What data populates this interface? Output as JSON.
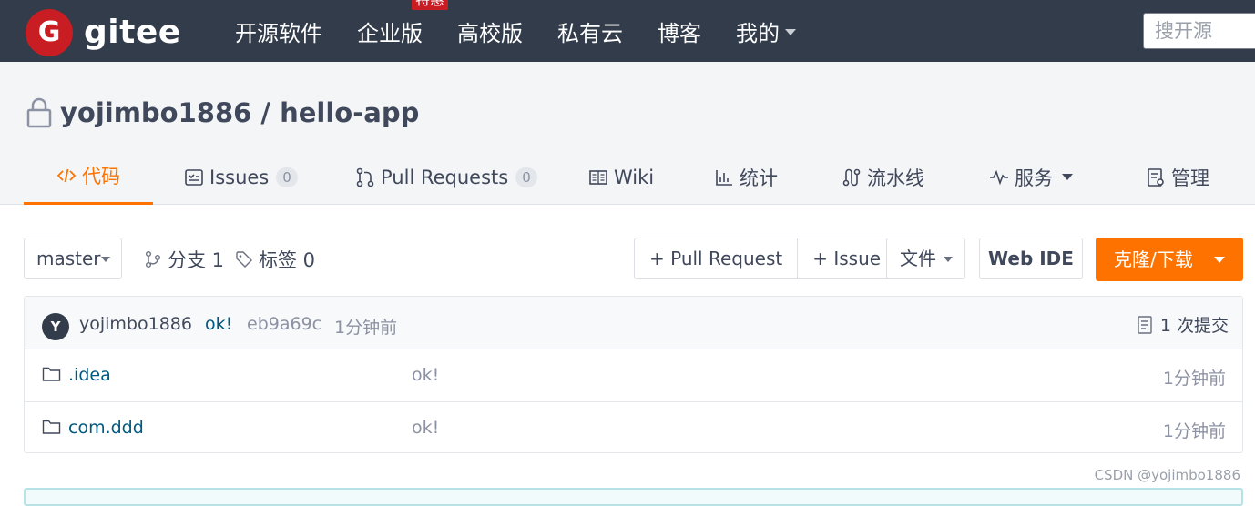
{
  "topbar": {
    "logo_glyph": "G",
    "logo_text": "gitee",
    "nav": [
      "开源软件",
      "企业版",
      "高校版",
      "私有云",
      "博客"
    ],
    "promo_badge": "特惠",
    "mine": "我的",
    "search_placeholder": "搜开源"
  },
  "repo": {
    "title": "yojimbo1886 / hello-app",
    "tabs": [
      {
        "label": "代码",
        "icon": "code-icon"
      },
      {
        "label": "Issues",
        "count": "0",
        "icon": "issues-icon"
      },
      {
        "label": "Pull Requests",
        "count": "0",
        "icon": "pull-request-icon"
      },
      {
        "label": "Wiki",
        "icon": "wiki-icon"
      },
      {
        "label": "统计",
        "icon": "stats-icon"
      },
      {
        "label": "流水线",
        "icon": "pipeline-icon"
      },
      {
        "label": "服务",
        "icon": "service-icon"
      },
      {
        "label": "管理",
        "icon": "manage-icon"
      }
    ]
  },
  "toolbar": {
    "branch": "master",
    "branches_label": "分支 1",
    "tags_label": "标签 0",
    "new_pr": "+ Pull Request",
    "new_issue": "+ Issue",
    "file_menu": "文件",
    "web_ide": "Web IDE",
    "clone": "克隆/下载"
  },
  "commit": {
    "avatar_letter": "Y",
    "author": "yojimbo1886",
    "message": "ok!",
    "hash": "eb9a69c",
    "time": "1分钟前",
    "count_label": "1 次提交"
  },
  "files": [
    {
      "name": ".idea",
      "message": "ok!",
      "time": "1分钟前"
    },
    {
      "name": "com.ddd",
      "message": "ok!",
      "time": "1分钟前"
    }
  ],
  "watermark": "CSDN @yojimbo1886",
  "colors": {
    "accent": "#fe7300",
    "navbar": "#323c4b",
    "brand_red": "#c71d23",
    "link": "#005980"
  }
}
